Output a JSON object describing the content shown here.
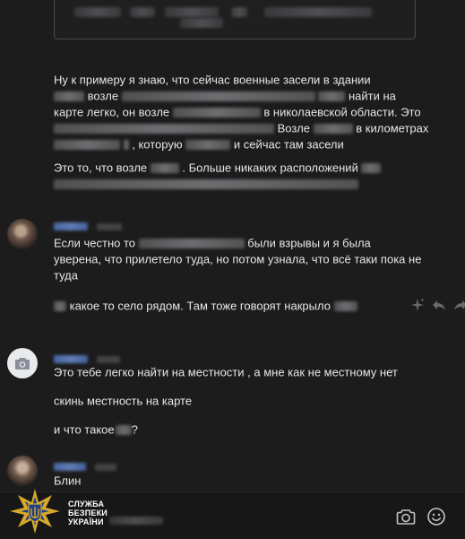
{
  "messages": {
    "m1": {
      "l1": "Ну к примеру я знаю, что сейчас военные засели в здании",
      "l2a": "возле",
      "l2b": "найти на",
      "l3a": "карте легко, он возле",
      "l3b": "в николаевской области. Это",
      "l4a": "Возле",
      "l4b": "в километрах",
      "l5a": ", которую",
      "l5b": "и сейчас там засели",
      "l6a": "Это то, что возле",
      "l6b": ". Больше никаких расположений"
    },
    "m2": {
      "l1a": "Если честно то",
      "l1b": "были взрывы и я была",
      "l2": "уверена, что прилетело туда, но потом узнала, что всё таки пока не",
      "l3": "туда",
      "l4": "какое то село рядом. Там тоже говорят накрыло"
    },
    "m3": {
      "l1": "Это тебе легко найти на местности , а мне как не местному нет",
      "l2": "скинь местность на карте",
      "l3": "и что такое",
      "l3end": "?"
    },
    "m4": {
      "l1": "Блин"
    }
  },
  "reactions": [
    "sparkle-icon",
    "reply-icon",
    "share-icon"
  ],
  "watermark": {
    "line1": "СЛУЖБА",
    "line2": "БЕЗПЕКИ",
    "line3": "УКРАЇНИ"
  },
  "colors": {
    "background": "#1c1c1d",
    "sender_name": "#5b82c8",
    "text": "#e6e6e6"
  }
}
